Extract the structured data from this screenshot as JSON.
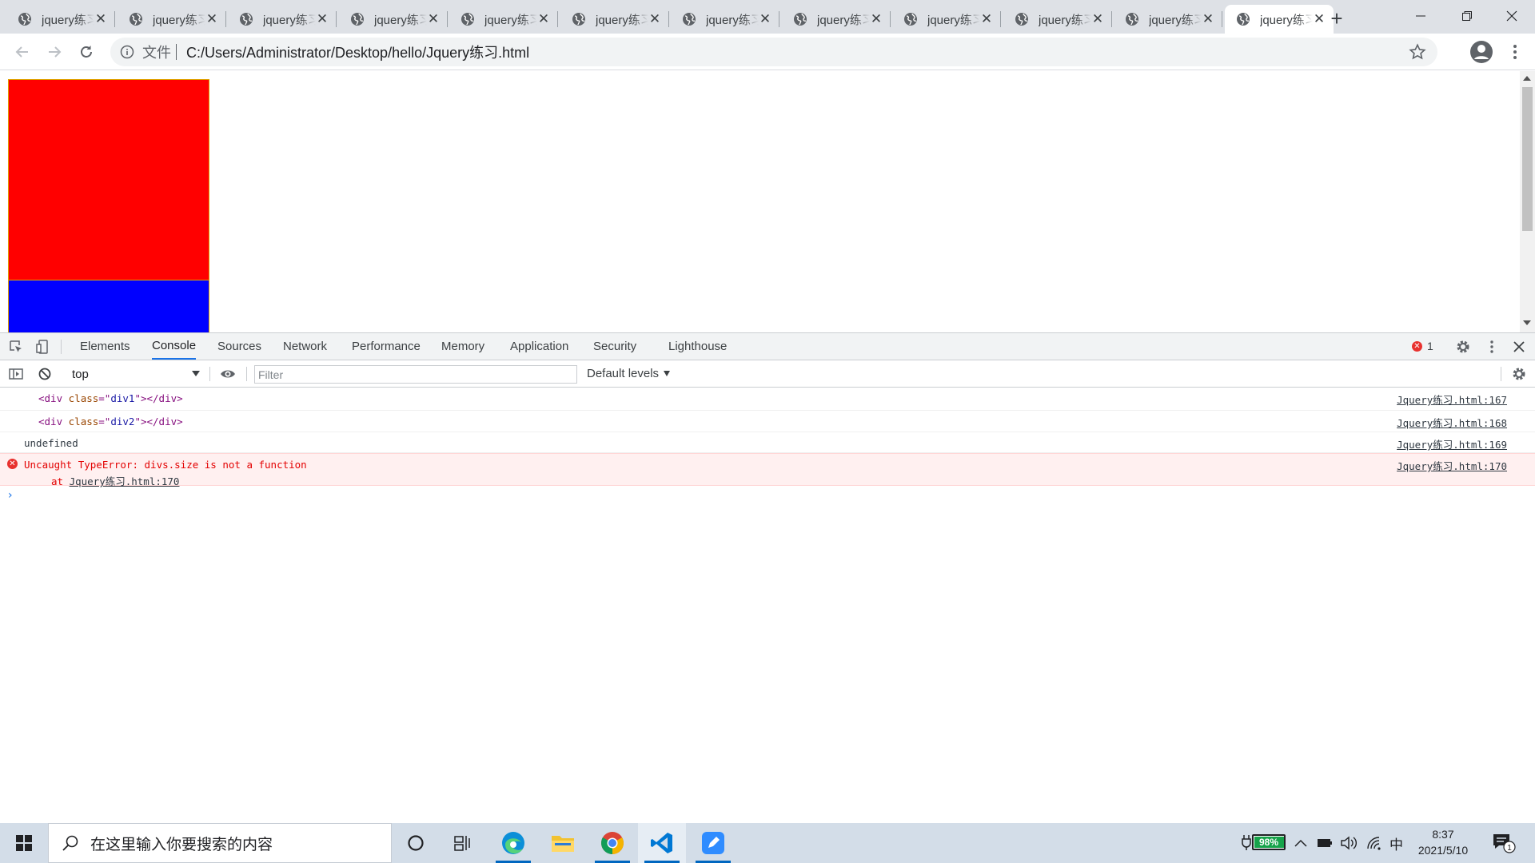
{
  "browser": {
    "tabs": [
      {
        "title": "jquery练习",
        "active": false
      },
      {
        "title": "jquery练习",
        "active": false
      },
      {
        "title": "jquery练习",
        "active": false
      },
      {
        "title": "jquery练习",
        "active": false
      },
      {
        "title": "jquery练习",
        "active": false
      },
      {
        "title": "jquery练习",
        "active": false
      },
      {
        "title": "jquery练习",
        "active": false
      },
      {
        "title": "jquery练习",
        "active": false
      },
      {
        "title": "jquery练习",
        "active": false
      },
      {
        "title": "jquery练习",
        "active": false
      },
      {
        "title": "jquery练习",
        "active": false
      },
      {
        "title": "jquery练习",
        "active": true
      }
    ],
    "omnibox": {
      "security_chip": "文件",
      "url": "C:/Users/Administrator/Desktop/hello/Jquery练习.html"
    }
  },
  "page": {
    "div1_color": "#ff0000",
    "div2_color": "#0000ff"
  },
  "devtools": {
    "tabs": [
      "Elements",
      "Console",
      "Sources",
      "Network",
      "Performance",
      "Memory",
      "Application",
      "Security",
      "Lighthouse"
    ],
    "active_tab": "Console",
    "error_count": "1",
    "context": "top",
    "filter_placeholder": "Filter",
    "levels": "Default levels",
    "console": {
      "rows": [
        {
          "tag_open": "<div ",
          "attr_name": "class",
          "attr_eq": "=\"",
          "attr_val": "div1",
          "tag_close": "\"></div>",
          "source": "Jquery练习.html:167"
        },
        {
          "tag_open": "<div ",
          "attr_name": "class",
          "attr_eq": "=\"",
          "attr_val": "div2",
          "tag_close": "\"></div>",
          "source": "Jquery练习.html:168"
        }
      ],
      "undefined_row": {
        "text": "undefined",
        "source": "Jquery练习.html:169"
      },
      "error_row": {
        "message": "Uncaught TypeError: divs.size is not a function",
        "stack_prefix": "at ",
        "stack_link": "Jquery练习.html:170",
        "source": "Jquery练习.html:170"
      }
    }
  },
  "taskbar": {
    "search_placeholder": "在这里输入你要搜索的内容",
    "battery_percent": "98%",
    "battery_level": 0.98,
    "ime": "中",
    "time": "8:37",
    "date": "2021/5/10",
    "notification_count": "1"
  }
}
